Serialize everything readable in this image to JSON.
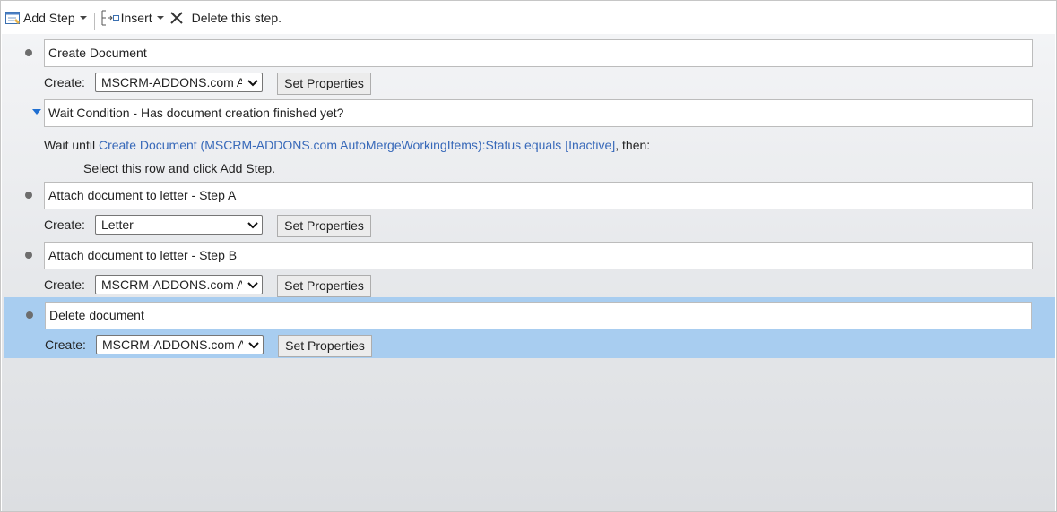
{
  "toolbar": {
    "add_step_label": "Add Step",
    "insert_label": "Insert",
    "delete_label": "Delete this step."
  },
  "steps": {
    "create_document": {
      "name": "Create Document",
      "create_label": "Create:",
      "entity": "MSCRM-ADDONS.com AutoMergeWorkingItems",
      "button": "Set Properties"
    },
    "wait": {
      "name": "Wait Condition - Has document creation finished yet?",
      "prefix": "Wait until ",
      "condition_link": "Create Document (MSCRM-ADDONS.com AutoMergeWorkingItems):Status equals [Inactive]",
      "suffix": ", then:",
      "hint": "Select this row and click Add Step."
    },
    "attach_a": {
      "name": "Attach document to letter - Step A",
      "create_label": "Create:",
      "entity": "Letter",
      "button": "Set Properties"
    },
    "attach_b": {
      "name": "Attach document to letter - Step B",
      "create_label": "Create:",
      "entity": "MSCRM-ADDONS.com AutoMergeWorkingItems",
      "button": "Set Properties"
    },
    "delete_document": {
      "name": "Delete document",
      "create_label": "Create:",
      "entity": "MSCRM-ADDONS.com AutoMergeWorkingItems",
      "button": "Set Properties"
    }
  },
  "colors": {
    "selection": "#a8cdf0",
    "link": "#3869b9",
    "collapse_arrow": "#1f6fd1"
  }
}
